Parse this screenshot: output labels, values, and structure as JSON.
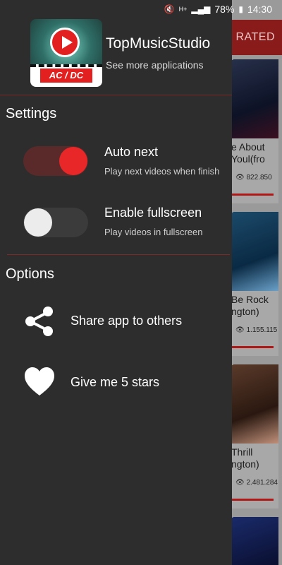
{
  "status_bar": {
    "battery": "78%",
    "time": "14:30",
    "icons": [
      "mute-icon",
      "hplus-icon",
      "signal-icon",
      "battery-icon"
    ]
  },
  "background": {
    "tab_label": "ST RATED",
    "cards": [
      {
        "title_line1": "e About",
        "title_line2": "Youl(fro",
        "views": "822.850"
      },
      {
        "title_line1": "Be Rock",
        "title_line2": "ngton)",
        "views": "1.155.115"
      },
      {
        "title_line1": "Thrill",
        "title_line2": "ngton)",
        "views": "2.481.284"
      }
    ]
  },
  "drawer": {
    "app_name": "TopMusicStudio",
    "app_sub": "See more applications",
    "logo_text": "AC / DC",
    "settings_title": "Settings",
    "settings": [
      {
        "title": "Auto next",
        "subtitle": "Play next videos when finish",
        "on": true
      },
      {
        "title": "Enable fullscreen",
        "subtitle": "Play videos in fullscreen",
        "on": false
      }
    ],
    "options_title": "Options",
    "options": [
      {
        "label": "Share app to others",
        "icon": "share-icon"
      },
      {
        "label": "Give me 5 stars",
        "icon": "heart-icon"
      }
    ]
  },
  "colors": {
    "accent": "#e82828",
    "drawer_bg": "#2d2d2d",
    "divider": "#7a2a2a"
  }
}
